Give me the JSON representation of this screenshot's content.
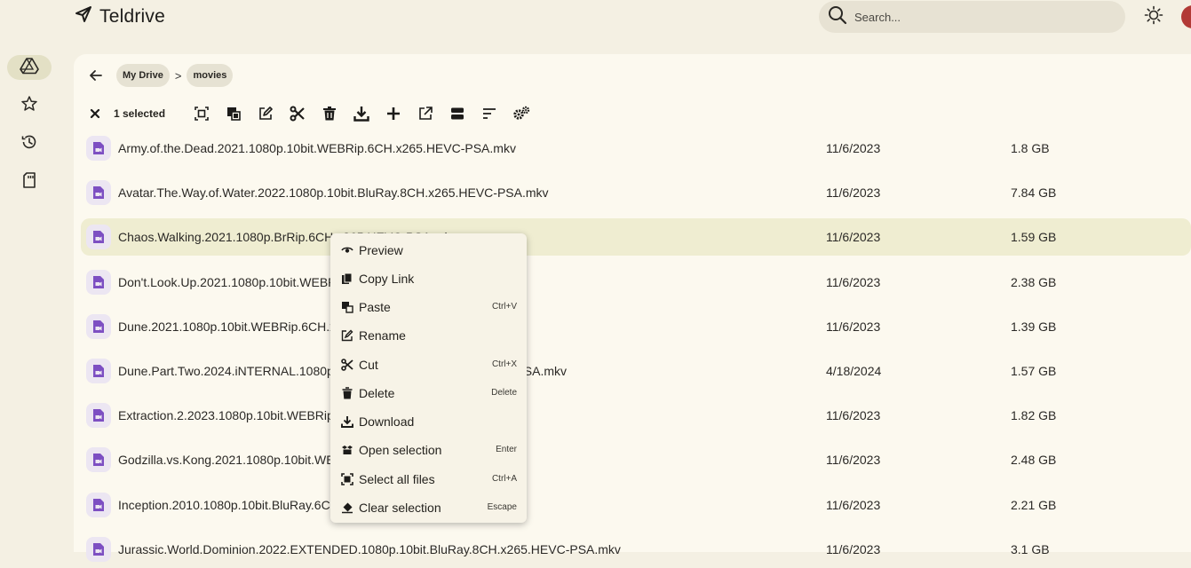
{
  "app": {
    "title": "Teldrive"
  },
  "search": {
    "placeholder": "Search..."
  },
  "breadcrumb": {
    "items": [
      "My Drive",
      "movies"
    ],
    "separator": ">"
  },
  "toolbar": {
    "selected_label": "1 selected"
  },
  "files": [
    {
      "name": "Army.of.the.Dead.2021.1080p.10bit.WEBRip.6CH.x265.HEVC-PSA.mkv",
      "date": "11/6/2023",
      "size": "1.8 GB"
    },
    {
      "name": "Avatar.The.Way.of.Water.2022.1080p.10bit.BluRay.8CH.x265.HEVC-PSA.mkv",
      "date": "11/6/2023",
      "size": "7.84 GB"
    },
    {
      "name": "Chaos.Walking.2021.1080p.BrRip.6CH.x265.HEVC-PSA.mkv",
      "date": "11/6/2023",
      "size": "1.59 GB"
    },
    {
      "name": "Don't.Look.Up.2021.1080p.10bit.WEBRip.6CH.x265.HEVC-PSA.mkv",
      "date": "11/6/2023",
      "size": "2.38 GB"
    },
    {
      "name": "Dune.2021.1080p.10bit.WEBRip.6CH.x265.HEVC-PSA.mkv",
      "date": "11/6/2023",
      "size": "1.39 GB"
    },
    {
      "name": "Dune.Part.Two.2024.iNTERNAL.1080p.10bit.WEBRip.6CH.x265.HEVC-PSA.mkv",
      "date": "4/18/2024",
      "size": "1.57 GB"
    },
    {
      "name": "Extraction.2.2023.1080p.10bit.WEBRip.6CH.x265.HEVC-PSA.mkv",
      "date": "11/6/2023",
      "size": "1.82 GB"
    },
    {
      "name": "Godzilla.vs.Kong.2021.1080p.10bit.WEBRip.6CH.x265.HEVC-PSA.mkv",
      "date": "11/6/2023",
      "size": "2.48 GB"
    },
    {
      "name": "Inception.2010.1080p.10bit.BluRay.6CH.x265.HEVC-PSA.mkv",
      "date": "11/6/2023",
      "size": "2.21 GB"
    },
    {
      "name": "Jurassic.World.Dominion.2022.EXTENDED.1080p.10bit.BluRay.8CH.x265.HEVC-PSA.mkv",
      "date": "11/6/2023",
      "size": "3.1 GB"
    }
  ],
  "context_menu": {
    "items": [
      {
        "label": "Preview",
        "shortcut": "",
        "icon": "eye-icon"
      },
      {
        "label": "Copy Link",
        "shortcut": "",
        "icon": "copy-icon"
      },
      {
        "label": "Paste",
        "shortcut": "Ctrl+V",
        "icon": "paste-icon"
      },
      {
        "label": "Rename",
        "shortcut": "",
        "icon": "edit-icon"
      },
      {
        "label": "Cut",
        "shortcut": "Ctrl+X",
        "icon": "scissors-icon"
      },
      {
        "label": "Delete",
        "shortcut": "Delete",
        "icon": "trash-icon"
      },
      {
        "label": "Download",
        "shortcut": "",
        "icon": "download-icon"
      },
      {
        "label": "Open selection",
        "shortcut": "Enter",
        "icon": "open-box-icon"
      },
      {
        "label": "Select all files",
        "shortcut": "Ctrl+A",
        "icon": "select-all-icon"
      },
      {
        "label": "Clear selection",
        "shortcut": "Escape",
        "icon": "eraser-icon"
      }
    ]
  },
  "colors": {
    "background": "#f4f0e3",
    "panel": "#fcf9ef",
    "selected_row": "#efedd1",
    "file_icon": "#7d4fc2",
    "menu": "#f7f3e7"
  }
}
